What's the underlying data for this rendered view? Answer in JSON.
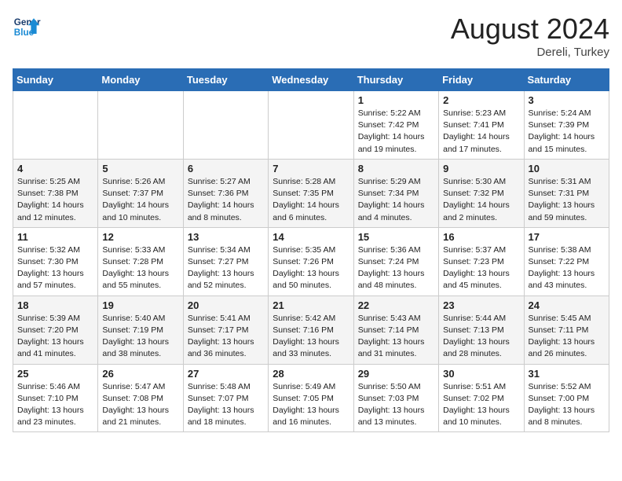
{
  "header": {
    "logo_general": "General",
    "logo_blue": "Blue",
    "month_year": "August 2024",
    "location": "Dereli, Turkey"
  },
  "days_of_week": [
    "Sunday",
    "Monday",
    "Tuesday",
    "Wednesday",
    "Thursday",
    "Friday",
    "Saturday"
  ],
  "weeks": [
    [
      {
        "day": "",
        "info": ""
      },
      {
        "day": "",
        "info": ""
      },
      {
        "day": "",
        "info": ""
      },
      {
        "day": "",
        "info": ""
      },
      {
        "day": "1",
        "info": "Sunrise: 5:22 AM\nSunset: 7:42 PM\nDaylight: 14 hours\nand 19 minutes."
      },
      {
        "day": "2",
        "info": "Sunrise: 5:23 AM\nSunset: 7:41 PM\nDaylight: 14 hours\nand 17 minutes."
      },
      {
        "day": "3",
        "info": "Sunrise: 5:24 AM\nSunset: 7:39 PM\nDaylight: 14 hours\nand 15 minutes."
      }
    ],
    [
      {
        "day": "4",
        "info": "Sunrise: 5:25 AM\nSunset: 7:38 PM\nDaylight: 14 hours\nand 12 minutes."
      },
      {
        "day": "5",
        "info": "Sunrise: 5:26 AM\nSunset: 7:37 PM\nDaylight: 14 hours\nand 10 minutes."
      },
      {
        "day": "6",
        "info": "Sunrise: 5:27 AM\nSunset: 7:36 PM\nDaylight: 14 hours\nand 8 minutes."
      },
      {
        "day": "7",
        "info": "Sunrise: 5:28 AM\nSunset: 7:35 PM\nDaylight: 14 hours\nand 6 minutes."
      },
      {
        "day": "8",
        "info": "Sunrise: 5:29 AM\nSunset: 7:34 PM\nDaylight: 14 hours\nand 4 minutes."
      },
      {
        "day": "9",
        "info": "Sunrise: 5:30 AM\nSunset: 7:32 PM\nDaylight: 14 hours\nand 2 minutes."
      },
      {
        "day": "10",
        "info": "Sunrise: 5:31 AM\nSunset: 7:31 PM\nDaylight: 13 hours\nand 59 minutes."
      }
    ],
    [
      {
        "day": "11",
        "info": "Sunrise: 5:32 AM\nSunset: 7:30 PM\nDaylight: 13 hours\nand 57 minutes."
      },
      {
        "day": "12",
        "info": "Sunrise: 5:33 AM\nSunset: 7:28 PM\nDaylight: 13 hours\nand 55 minutes."
      },
      {
        "day": "13",
        "info": "Sunrise: 5:34 AM\nSunset: 7:27 PM\nDaylight: 13 hours\nand 52 minutes."
      },
      {
        "day": "14",
        "info": "Sunrise: 5:35 AM\nSunset: 7:26 PM\nDaylight: 13 hours\nand 50 minutes."
      },
      {
        "day": "15",
        "info": "Sunrise: 5:36 AM\nSunset: 7:24 PM\nDaylight: 13 hours\nand 48 minutes."
      },
      {
        "day": "16",
        "info": "Sunrise: 5:37 AM\nSunset: 7:23 PM\nDaylight: 13 hours\nand 45 minutes."
      },
      {
        "day": "17",
        "info": "Sunrise: 5:38 AM\nSunset: 7:22 PM\nDaylight: 13 hours\nand 43 minutes."
      }
    ],
    [
      {
        "day": "18",
        "info": "Sunrise: 5:39 AM\nSunset: 7:20 PM\nDaylight: 13 hours\nand 41 minutes."
      },
      {
        "day": "19",
        "info": "Sunrise: 5:40 AM\nSunset: 7:19 PM\nDaylight: 13 hours\nand 38 minutes."
      },
      {
        "day": "20",
        "info": "Sunrise: 5:41 AM\nSunset: 7:17 PM\nDaylight: 13 hours\nand 36 minutes."
      },
      {
        "day": "21",
        "info": "Sunrise: 5:42 AM\nSunset: 7:16 PM\nDaylight: 13 hours\nand 33 minutes."
      },
      {
        "day": "22",
        "info": "Sunrise: 5:43 AM\nSunset: 7:14 PM\nDaylight: 13 hours\nand 31 minutes."
      },
      {
        "day": "23",
        "info": "Sunrise: 5:44 AM\nSunset: 7:13 PM\nDaylight: 13 hours\nand 28 minutes."
      },
      {
        "day": "24",
        "info": "Sunrise: 5:45 AM\nSunset: 7:11 PM\nDaylight: 13 hours\nand 26 minutes."
      }
    ],
    [
      {
        "day": "25",
        "info": "Sunrise: 5:46 AM\nSunset: 7:10 PM\nDaylight: 13 hours\nand 23 minutes."
      },
      {
        "day": "26",
        "info": "Sunrise: 5:47 AM\nSunset: 7:08 PM\nDaylight: 13 hours\nand 21 minutes."
      },
      {
        "day": "27",
        "info": "Sunrise: 5:48 AM\nSunset: 7:07 PM\nDaylight: 13 hours\nand 18 minutes."
      },
      {
        "day": "28",
        "info": "Sunrise: 5:49 AM\nSunset: 7:05 PM\nDaylight: 13 hours\nand 16 minutes."
      },
      {
        "day": "29",
        "info": "Sunrise: 5:50 AM\nSunset: 7:03 PM\nDaylight: 13 hours\nand 13 minutes."
      },
      {
        "day": "30",
        "info": "Sunrise: 5:51 AM\nSunset: 7:02 PM\nDaylight: 13 hours\nand 10 minutes."
      },
      {
        "day": "31",
        "info": "Sunrise: 5:52 AM\nSunset: 7:00 PM\nDaylight: 13 hours\nand 8 minutes."
      }
    ]
  ]
}
